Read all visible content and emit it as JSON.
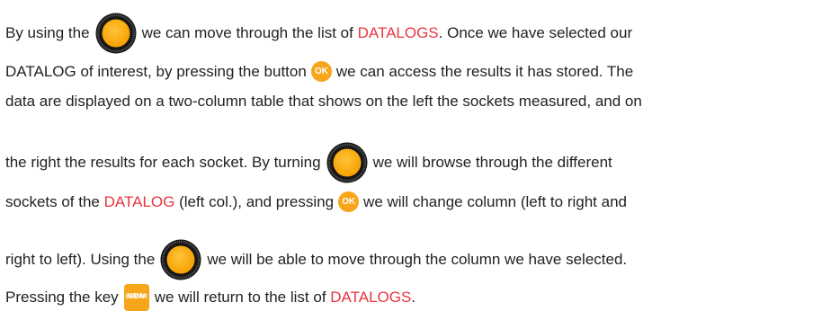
{
  "colors": {
    "text": "#222222",
    "highlight": "#e8363f",
    "button": "#f7a51b",
    "knob_ring": "#1a1a1a"
  },
  "icons": {
    "knob": "rotary-knob-icon",
    "ok": "ok-button-icon",
    "clear_menu": "clear-menu-key-icon"
  },
  "buttons": {
    "ok_label": "OK",
    "clear_label": "CLEAR",
    "menu_label": "MENU"
  },
  "paragraph": {
    "l1_a": "By using the",
    "l1_b": "we can move through the list of",
    "l1_c": "DATALOGS",
    "l1_d": ". Once we have selected our",
    "l2_a": "DATALOG of interest, by pressing the button",
    "l2_b": "we can access the results it has stored. The",
    "l3": "data are displayed on a two-column table that shows on the left the sockets measured, and on",
    "l4_a": "the right the results for each socket. By turning",
    "l4_b": "we will browse through the different",
    "l5_a": "sockets of the",
    "l5_b": "DATALOG",
    "l5_c": " (left col.), and pressing",
    "l5_d": "we will change column (left to right and",
    "l6_a": "right to left). Using the",
    "l6_b": "we will be able to move through the column we have selected.",
    "l7_a": "Pressing the key",
    "l7_b": "we will return to the list of",
    "l7_c": "DATALOGS",
    "l7_d": "."
  }
}
